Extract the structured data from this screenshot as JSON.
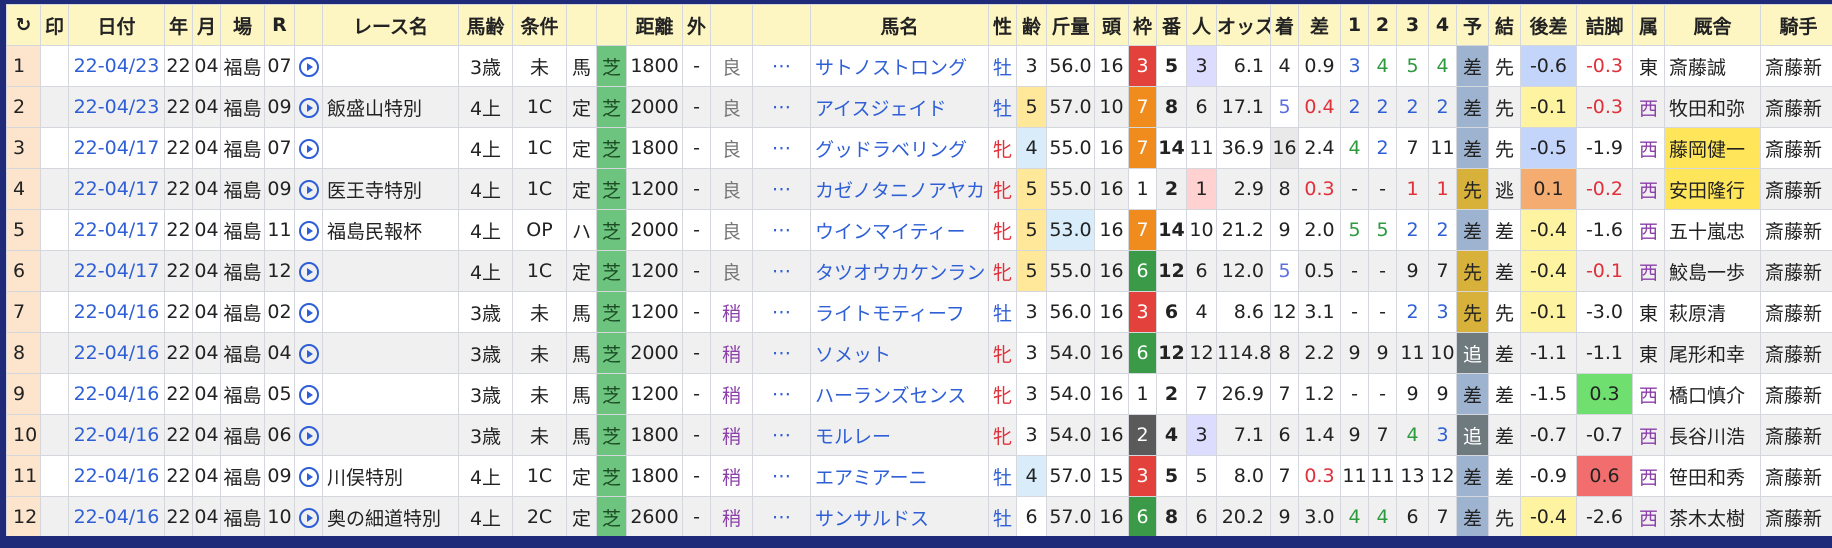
{
  "headers": [
    "↻",
    "印",
    "日付",
    "年",
    "月",
    "場",
    "R",
    "",
    "レース名",
    "馬齢",
    "条件",
    "",
    "",
    "距離",
    "外",
    "",
    "",
    "馬名",
    "性",
    "齢",
    "斤量",
    "頭",
    "枠",
    "番",
    "人",
    "オッズ",
    "着",
    "差",
    "1",
    "2",
    "3",
    "4",
    "予",
    "結",
    "後差",
    "詰脚",
    "属",
    "厩舎",
    "騎手"
  ],
  "colors": {
    "turf": "#6cc47e",
    "frame3": "#e2413c",
    "frame6": "#3b9a48",
    "frame7": "#f08b1e",
    "frame2": "#5a5a5a",
    "link": "#2e5fd6",
    "header": "#fdf6c3"
  },
  "rows": [
    {
      "no": "1",
      "date": "22-04/23",
      "yr": "22",
      "mo": "04",
      "track": "福島",
      "r": "07",
      "race": "",
      "age": "3歳",
      "cond": "未",
      "kind": "馬",
      "surf": "芝",
      "dist": "1800",
      "out": "-",
      "going": "良",
      "horse": "サトノストロング",
      "sex": "牡",
      "hage": "3",
      "wt": "56.0",
      "fld": "16",
      "frame": "3",
      "num": "5",
      "pop": "3",
      "odds": "6.1",
      "fin": "4",
      "diff": "0.9",
      "c1": "3",
      "c2": "4",
      "c3": "5",
      "c4": "4",
      "pred": "差",
      "res": "先",
      "kosa": "-0.6",
      "tsume": "-0.3",
      "area": "東",
      "trainer": "斎藤誠",
      "jockey": "斎藤新"
    },
    {
      "no": "2",
      "date": "22-04/23",
      "yr": "22",
      "mo": "04",
      "track": "福島",
      "r": "09",
      "race": "飯盛山特別",
      "age": "4上",
      "cond": "1C",
      "kind": "定",
      "surf": "芝",
      "dist": "2000",
      "out": "-",
      "going": "良",
      "horse": "アイスジェイド",
      "sex": "牡",
      "hage": "5",
      "wt": "57.0",
      "fld": "10",
      "frame": "7",
      "num": "8",
      "pop": "6",
      "odds": "17.1",
      "fin": "5",
      "diff": "0.4",
      "c1": "2",
      "c2": "2",
      "c3": "2",
      "c4": "2",
      "pred": "差",
      "res": "先",
      "kosa": "-0.1",
      "tsume": "-0.3",
      "area": "西",
      "trainer": "牧田和弥",
      "jockey": "斎藤新"
    },
    {
      "no": "3",
      "date": "22-04/17",
      "yr": "22",
      "mo": "04",
      "track": "福島",
      "r": "07",
      "race": "",
      "age": "4上",
      "cond": "1C",
      "kind": "定",
      "surf": "芝",
      "dist": "1800",
      "out": "-",
      "going": "良",
      "horse": "グッドラベリング",
      "sex": "牝",
      "hage": "4",
      "wt": "55.0",
      "fld": "16",
      "frame": "7",
      "num": "14",
      "pop": "11",
      "odds": "36.9",
      "fin": "16",
      "diff": "2.4",
      "c1": "4",
      "c2": "2",
      "c3": "7",
      "c4": "11",
      "pred": "差",
      "res": "先",
      "kosa": "-0.5",
      "tsume": "-1.9",
      "area": "西",
      "trainer": "藤岡健一",
      "jockey": "斎藤新"
    },
    {
      "no": "4",
      "date": "22-04/17",
      "yr": "22",
      "mo": "04",
      "track": "福島",
      "r": "09",
      "race": "医王寺特別",
      "age": "4上",
      "cond": "1C",
      "kind": "定",
      "surf": "芝",
      "dist": "1200",
      "out": "-",
      "going": "良",
      "horse": "カゼノタニノアヤカ",
      "sex": "牝",
      "hage": "5",
      "wt": "55.0",
      "fld": "16",
      "frame": "1",
      "num": "2",
      "pop": "1",
      "odds": "2.9",
      "fin": "8",
      "diff": "0.3",
      "c1": "-",
      "c2": "-",
      "c3": "1",
      "c4": "1",
      "pred": "先",
      "res": "逃",
      "kosa": "0.1",
      "tsume": "-0.2",
      "area": "西",
      "trainer": "安田隆行",
      "jockey": "斎藤新"
    },
    {
      "no": "5",
      "date": "22-04/17",
      "yr": "22",
      "mo": "04",
      "track": "福島",
      "r": "11",
      "race": "福島民報杯",
      "age": "4上",
      "cond": "OP",
      "kind": "ハ",
      "surf": "芝",
      "dist": "2000",
      "out": "-",
      "going": "良",
      "horse": "ウインマイティー",
      "sex": "牝",
      "hage": "5",
      "wt": "53.0",
      "fld": "16",
      "frame": "7",
      "num": "14",
      "pop": "10",
      "odds": "21.2",
      "fin": "9",
      "diff": "2.0",
      "c1": "5",
      "c2": "5",
      "c3": "2",
      "c4": "2",
      "pred": "差",
      "res": "差",
      "kosa": "-0.4",
      "tsume": "-1.6",
      "area": "西",
      "trainer": "五十嵐忠",
      "jockey": "斎藤新"
    },
    {
      "no": "6",
      "date": "22-04/17",
      "yr": "22",
      "mo": "04",
      "track": "福島",
      "r": "12",
      "race": "",
      "age": "4上",
      "cond": "1C",
      "kind": "定",
      "surf": "芝",
      "dist": "1200",
      "out": "-",
      "going": "良",
      "horse": "タツオウカケンラン",
      "sex": "牝",
      "hage": "5",
      "wt": "55.0",
      "fld": "16",
      "frame": "6",
      "num": "12",
      "pop": "6",
      "odds": "12.0",
      "fin": "5",
      "diff": "0.5",
      "c1": "-",
      "c2": "-",
      "c3": "9",
      "c4": "7",
      "pred": "先",
      "res": "差",
      "kosa": "-0.4",
      "tsume": "-0.1",
      "area": "西",
      "trainer": "鮫島一歩",
      "jockey": "斎藤新"
    },
    {
      "no": "7",
      "date": "22-04/16",
      "yr": "22",
      "mo": "04",
      "track": "福島",
      "r": "02",
      "race": "",
      "age": "3歳",
      "cond": "未",
      "kind": "馬",
      "surf": "芝",
      "dist": "1200",
      "out": "-",
      "going": "稍",
      "horse": "ライトモティーフ",
      "sex": "牡",
      "hage": "3",
      "wt": "56.0",
      "fld": "16",
      "frame": "3",
      "num": "6",
      "pop": "4",
      "odds": "8.6",
      "fin": "12",
      "diff": "3.1",
      "c1": "-",
      "c2": "-",
      "c3": "2",
      "c4": "3",
      "pred": "先",
      "res": "先",
      "kosa": "-0.1",
      "tsume": "-3.0",
      "area": "東",
      "trainer": "萩原清",
      "jockey": "斎藤新"
    },
    {
      "no": "8",
      "date": "22-04/16",
      "yr": "22",
      "mo": "04",
      "track": "福島",
      "r": "04",
      "race": "",
      "age": "3歳",
      "cond": "未",
      "kind": "馬",
      "surf": "芝",
      "dist": "2000",
      "out": "-",
      "going": "稍",
      "horse": "ソメット",
      "sex": "牝",
      "hage": "3",
      "wt": "54.0",
      "fld": "16",
      "frame": "6",
      "num": "12",
      "pop": "12",
      "odds": "114.8",
      "fin": "8",
      "diff": "2.2",
      "c1": "9",
      "c2": "9",
      "c3": "11",
      "c4": "10",
      "pred": "追",
      "res": "差",
      "kosa": "-1.1",
      "tsume": "-1.1",
      "area": "東",
      "trainer": "尾形和幸",
      "jockey": "斎藤新"
    },
    {
      "no": "9",
      "date": "22-04/16",
      "yr": "22",
      "mo": "04",
      "track": "福島",
      "r": "05",
      "race": "",
      "age": "3歳",
      "cond": "未",
      "kind": "馬",
      "surf": "芝",
      "dist": "1200",
      "out": "-",
      "going": "稍",
      "horse": "ハーランズセンス",
      "sex": "牝",
      "hage": "3",
      "wt": "54.0",
      "fld": "16",
      "frame": "1",
      "num": "2",
      "pop": "7",
      "odds": "26.9",
      "fin": "7",
      "diff": "1.2",
      "c1": "-",
      "c2": "-",
      "c3": "9",
      "c4": "9",
      "pred": "差",
      "res": "差",
      "kosa": "-1.5",
      "tsume": "0.3",
      "area": "西",
      "trainer": "橋口慎介",
      "jockey": "斎藤新"
    },
    {
      "no": "10",
      "date": "22-04/16",
      "yr": "22",
      "mo": "04",
      "track": "福島",
      "r": "06",
      "race": "",
      "age": "3歳",
      "cond": "未",
      "kind": "馬",
      "surf": "芝",
      "dist": "1800",
      "out": "-",
      "going": "稍",
      "horse": "モルレー",
      "sex": "牝",
      "hage": "3",
      "wt": "54.0",
      "fld": "16",
      "frame": "2",
      "num": "4",
      "pop": "3",
      "odds": "7.1",
      "fin": "6",
      "diff": "1.4",
      "c1": "9",
      "c2": "7",
      "c3": "4",
      "c4": "3",
      "pred": "追",
      "res": "差",
      "kosa": "-0.7",
      "tsume": "-0.7",
      "area": "西",
      "trainer": "長谷川浩",
      "jockey": "斎藤新"
    },
    {
      "no": "11",
      "date": "22-04/16",
      "yr": "22",
      "mo": "04",
      "track": "福島",
      "r": "09",
      "race": "川俣特別",
      "age": "4上",
      "cond": "1C",
      "kind": "定",
      "surf": "芝",
      "dist": "1800",
      "out": "-",
      "going": "稍",
      "horse": "エアミアーニ",
      "sex": "牡",
      "hage": "4",
      "wt": "57.0",
      "fld": "15",
      "frame": "3",
      "num": "5",
      "pop": "5",
      "odds": "8.0",
      "fin": "7",
      "diff": "0.3",
      "c1": "11",
      "c2": "11",
      "c3": "13",
      "c4": "12",
      "pred": "差",
      "res": "差",
      "kosa": "-0.9",
      "tsume": "0.6",
      "area": "西",
      "trainer": "笹田和秀",
      "jockey": "斎藤新"
    },
    {
      "no": "12",
      "date": "22-04/16",
      "yr": "22",
      "mo": "04",
      "track": "福島",
      "r": "10",
      "race": "奥の細道特別",
      "age": "4上",
      "cond": "2C",
      "kind": "定",
      "surf": "芝",
      "dist": "2600",
      "out": "-",
      "going": "稍",
      "horse": "サンサルドス",
      "sex": "牡",
      "hage": "6",
      "wt": "57.0",
      "fld": "16",
      "frame": "6",
      "num": "8",
      "pop": "6",
      "odds": "20.2",
      "fin": "9",
      "diff": "3.0",
      "c1": "4",
      "c2": "4",
      "c3": "6",
      "c4": "7",
      "pred": "差",
      "res": "先",
      "kosa": "-0.4",
      "tsume": "-2.6",
      "area": "西",
      "trainer": "茶木太樹",
      "jockey": "斎藤新"
    }
  ]
}
